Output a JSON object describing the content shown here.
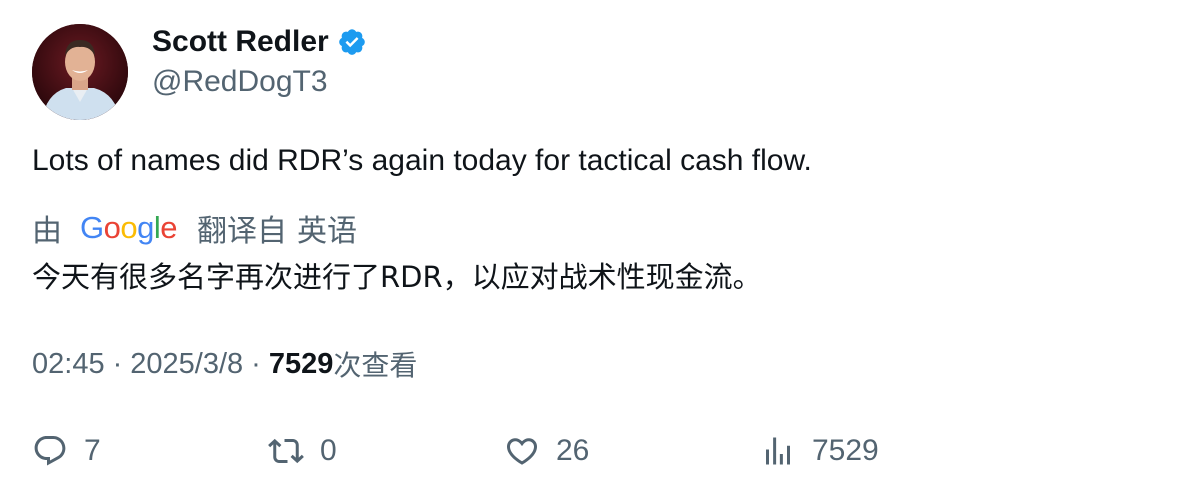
{
  "author": {
    "name": "Scott Redler",
    "handle": "@RedDogT3",
    "verified": true,
    "verified_color": "#1d9bf0"
  },
  "tweet": {
    "text": "Lots of names did RDR’s again today for tactical cash flow."
  },
  "translation": {
    "by_label": "由",
    "provider_letters": [
      "G",
      "o",
      "o",
      "g",
      "l",
      "e"
    ],
    "provider_colors": [
      "#4285F4",
      "#EA4335",
      "#FBBC05",
      "#4285F4",
      "#34A853",
      "#EA4335"
    ],
    "translated_from_label": "翻译自",
    "source_language": "英语",
    "text": "今天有很多名字再次进行了RDR，以应对战术性现金流。"
  },
  "meta": {
    "time": "02:45",
    "separator": "·",
    "date": "2025/3/8",
    "views_count": "7529",
    "views_label": "次查看"
  },
  "actions": {
    "reply_count": "7",
    "retweet_count": "0",
    "like_count": "26",
    "views_count": "7529"
  },
  "colors": {
    "text_primary": "#0f1419",
    "text_secondary": "#536471",
    "background": "#ffffff"
  },
  "icons": {
    "reply": "reply-icon",
    "retweet": "retweet-icon",
    "like": "heart-icon",
    "views": "analytics-icon",
    "verified": "verified-badge-icon"
  }
}
